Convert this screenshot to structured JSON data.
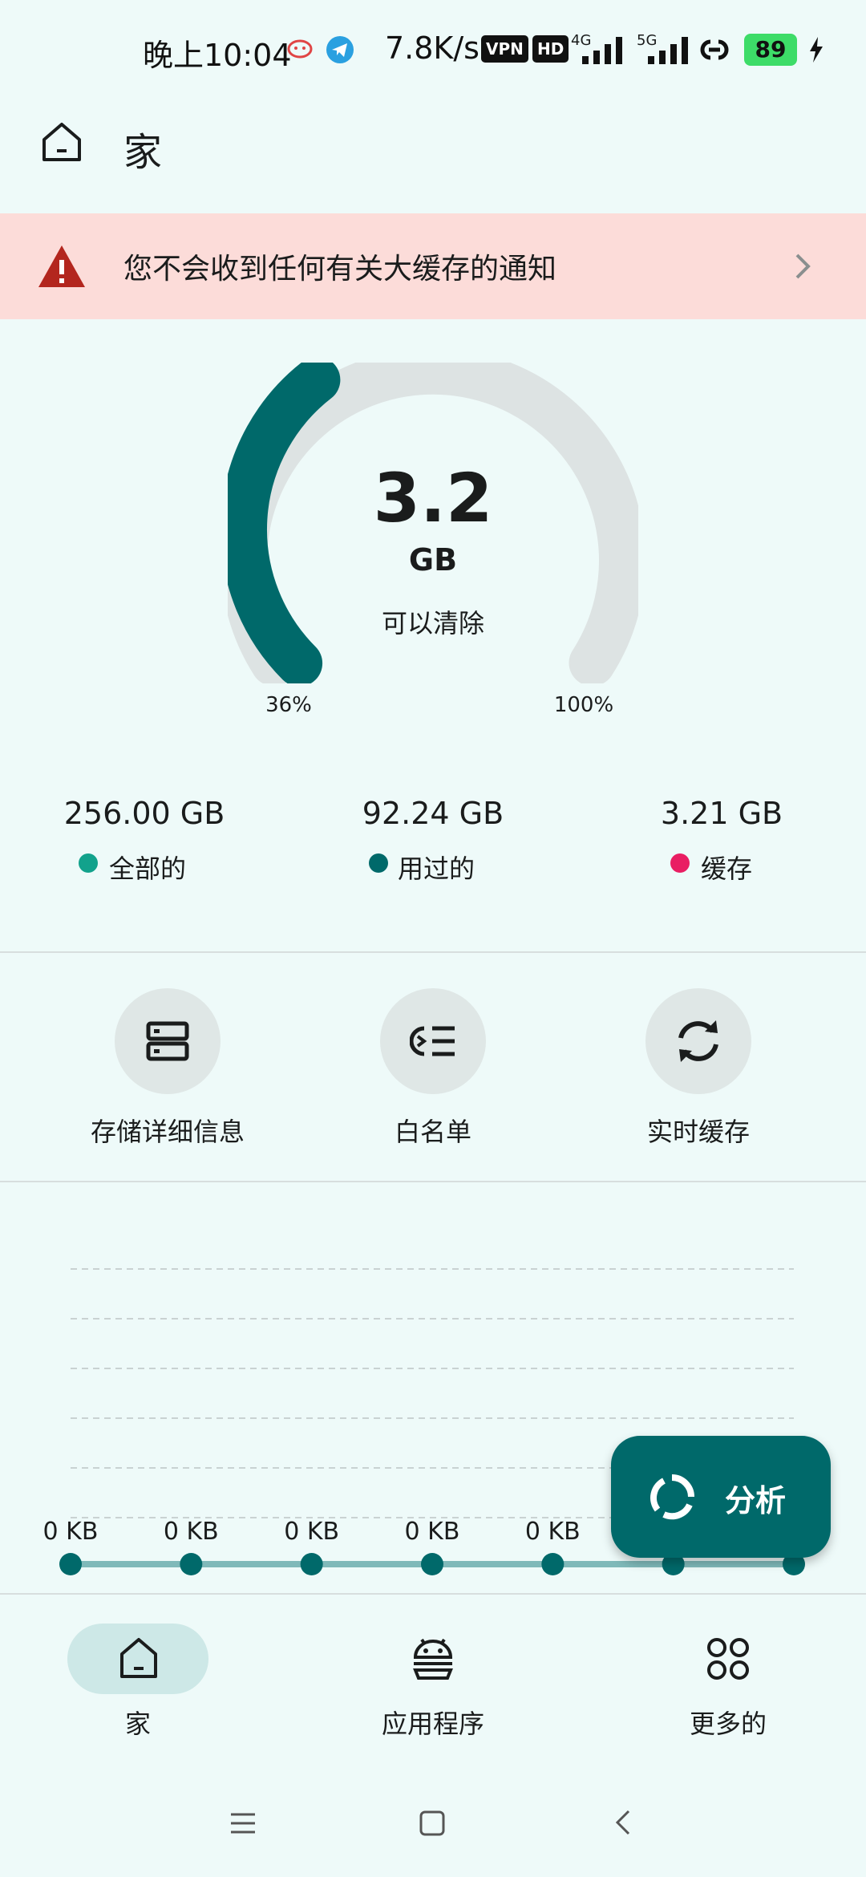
{
  "status_bar": {
    "time": "晚上10:04",
    "speed": "7.8K/s",
    "vpn_badge": "VPN",
    "hd_badge": "HD",
    "battery": "89",
    "net_4g": "4G",
    "net_5g": "5G"
  },
  "header": {
    "title": "家",
    "icon": "home-icon"
  },
  "warning": {
    "text": "您不会收到任何有关大缓存的通知",
    "icon": "warning-icon"
  },
  "gauge": {
    "value": "3.2",
    "unit": "GB",
    "caption": "可以清除",
    "min_label": "36%",
    "max_label": "100%",
    "fill_fraction": 0.36
  },
  "stats": [
    {
      "value": "256.00 GB",
      "label": "全部的",
      "color": "#12a28c"
    },
    {
      "value": "92.24 GB",
      "label": "用过的",
      "color": "#00696a"
    },
    {
      "value": "3.21 GB",
      "label": "缓存",
      "color": "#e91e63"
    }
  ],
  "actions": [
    {
      "label": "存储详细信息",
      "icon": "storage-icon"
    },
    {
      "label": "白名单",
      "icon": "whitelist-icon"
    },
    {
      "label": "实时缓存",
      "icon": "sync-icon"
    }
  ],
  "chart_data": {
    "type": "line",
    "labels": [
      "0 KB",
      "0 KB",
      "0 KB",
      "0 KB",
      "0 KB",
      "",
      ""
    ],
    "values": [
      0,
      0,
      0,
      0,
      0,
      0,
      0
    ],
    "grid": true
  },
  "fab": {
    "label": "分析",
    "icon": "analyze-icon"
  },
  "bottom_nav": [
    {
      "label": "家",
      "icon": "home-icon",
      "active": true
    },
    {
      "label": "应用程序",
      "icon": "android-icon",
      "active": false
    },
    {
      "label": "更多的",
      "icon": "apps-grid-icon",
      "active": false
    }
  ],
  "system_nav": [
    "menu-icon",
    "home-square-icon",
    "back-icon"
  ],
  "colors": {
    "accent": "#00696a",
    "background": "#eefaf9",
    "warning_bg": "#fcdcd9",
    "warning_icon": "#b3261e"
  }
}
